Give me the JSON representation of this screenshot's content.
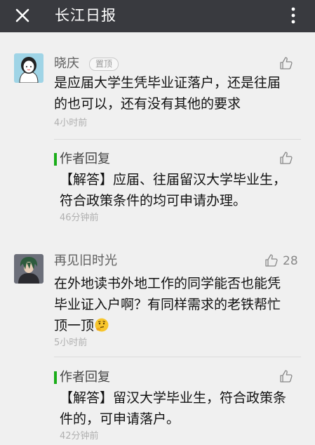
{
  "header": {
    "title": "长江日报",
    "close_icon": "close-icon",
    "more_icon": "more-vertical-icon"
  },
  "comments": [
    {
      "author": "晓庆",
      "badge": "置顶",
      "likes": "",
      "text_lines": [
        "是应届大学生凭毕业证落户，还是往届",
        "的也可以，还有没有其他的要求"
      ],
      "time": "4小时前",
      "reply": {
        "label": "作者回复",
        "text_lines": [
          "【解答】应届、往届留汉大学毕业生，",
          "符合政策条件的均可申请办理。"
        ],
        "time": "46分钟前"
      }
    },
    {
      "author": "再见旧时光",
      "badge": "",
      "likes": "28",
      "text_lines": [
        "在外地读书外地工作的同学能否也能凭",
        "毕业证入户啊？有同样需求的老铁帮忙",
        "顶一顶"
      ],
      "time": "5小时前",
      "reply": {
        "label": "作者回复",
        "text_lines": [
          "【解答】留汉大学毕业生，符合政策条",
          "件的，可申请落户。"
        ],
        "time": "42分钟前"
      }
    }
  ],
  "colors": {
    "topbar": "#393a3f",
    "background": "#f0f0f0",
    "reply_bar": "#1aad19"
  }
}
